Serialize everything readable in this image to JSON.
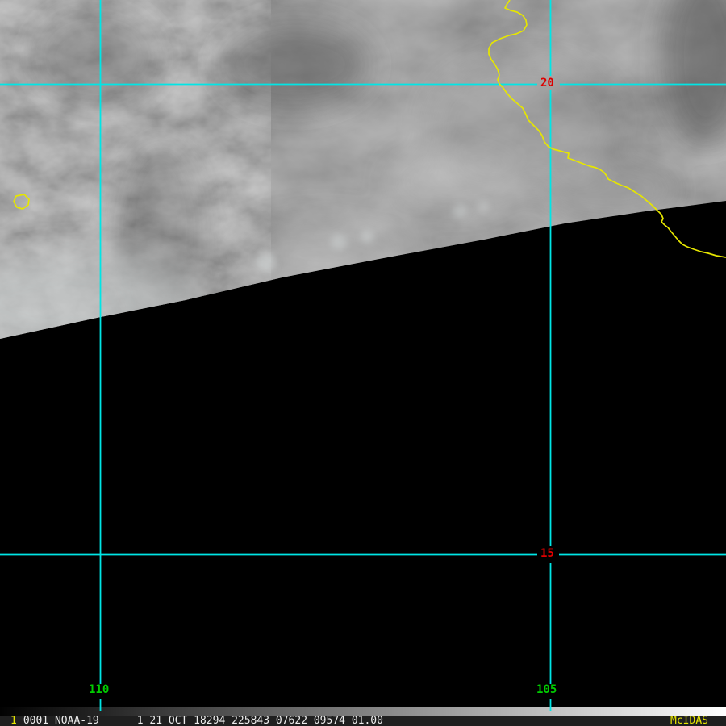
{
  "display": {
    "satellite": "NOAA-19",
    "no_data_region_color": "#000000"
  },
  "grid": {
    "line_color": "#00e6e6",
    "lat_labels": [
      {
        "value": "20",
        "color": "#dd0000"
      },
      {
        "value": "15",
        "color": "#dd0000"
      }
    ],
    "lon_labels": [
      {
        "value": "110",
        "color": "#00cc00"
      },
      {
        "value": "105",
        "color": "#00cc00"
      }
    ]
  },
  "map_overlay": {
    "coastline_color": "#e6e600"
  },
  "brightness_bar": {
    "left_color": "#000000",
    "right_color": "#ffffff"
  },
  "status_bar": {
    "frame_number": "1",
    "image_label": "0001 NOAA-19      1 21 OCT 18294 225843 07622 09574 01.00",
    "brand": "McIDAS",
    "background": "#1f1f1f",
    "text_color": "#ededed",
    "accent_color": "#e8e800"
  }
}
